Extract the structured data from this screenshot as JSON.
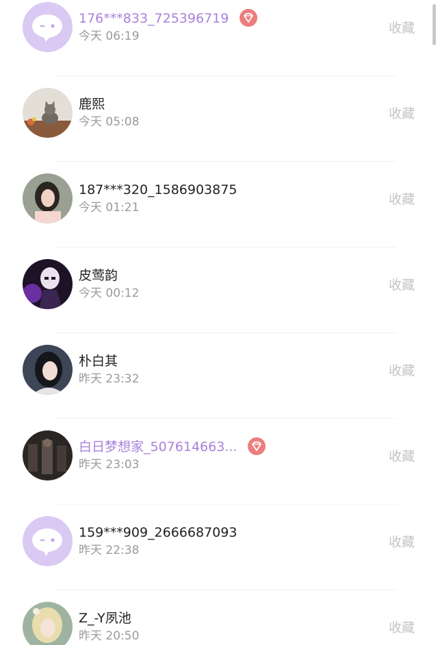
{
  "colors": {
    "vip_name": "#a880dc",
    "vip_badge": "#ec7e7e",
    "default_avatar_bg": "#d9c9f3",
    "time_text": "#9a9a9a",
    "favorite_text": "#c4c4c4"
  },
  "rows": [
    {
      "name": "176***833_725396719",
      "time": "今天 06:19",
      "action": "收藏",
      "vip": true,
      "avatar": "default-chat-bubble"
    },
    {
      "name": "鹿熙",
      "time": "今天 05:08",
      "action": "收藏",
      "vip": false,
      "avatar": "cat-photo"
    },
    {
      "name": "187***320_1586903875",
      "time": "今天 01:21",
      "action": "收藏",
      "vip": false,
      "avatar": "girl-photo"
    },
    {
      "name": "皮莺韵",
      "time": "今天 00:12",
      "action": "收藏",
      "vip": false,
      "avatar": "dark-anime-character"
    },
    {
      "name": "朴白其",
      "time": "昨天 23:32",
      "action": "收藏",
      "vip": false,
      "avatar": "girl-portrait"
    },
    {
      "name": "白日梦想家_507614663...",
      "time": "昨天 23:03",
      "action": "收藏",
      "vip": true,
      "avatar": "group-dark-photo"
    },
    {
      "name": "159***909_2666687093",
      "time": "昨天 22:38",
      "action": "收藏",
      "vip": false,
      "avatar": "default-chat-bubble"
    },
    {
      "name": "Z_-Y夙池",
      "time": "昨天 20:50",
      "action": "收藏",
      "vip": false,
      "avatar": "blonde-fantasy-portrait"
    }
  ]
}
